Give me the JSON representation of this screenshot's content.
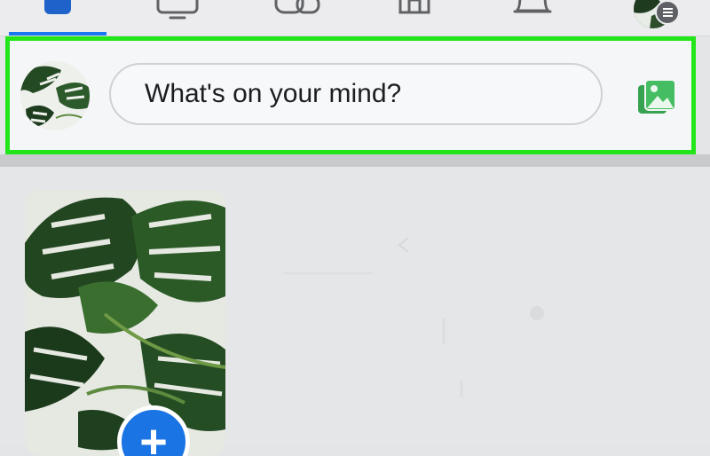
{
  "nav": {
    "tabs": [
      {
        "icon": "home-icon",
        "active": true
      },
      {
        "icon": "watch-icon"
      },
      {
        "icon": "groups-icon"
      },
      {
        "icon": "marketplace-icon"
      },
      {
        "icon": "notifications-icon"
      },
      {
        "icon": "profile-menu-icon"
      }
    ],
    "active_color": "#1877f2"
  },
  "composer": {
    "placeholder": "What's on your mind?",
    "highlight_color": "#23e61a",
    "photo_icon": "photo-icon",
    "photo_icon_color": "#45bd62"
  },
  "stories": {
    "create_icon": "plus-icon",
    "create_button_color": "#1b74e4"
  }
}
